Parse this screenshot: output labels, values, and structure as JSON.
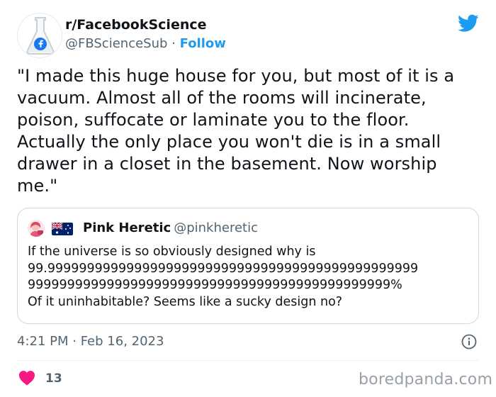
{
  "tweet": {
    "author_name": "r/FacebookScience",
    "author_handle": "@FBScienceSub",
    "separator": "·",
    "follow_label": "Follow",
    "text": "\"I made this huge house for you, but most of it is a vacuum. Almost all of the rooms will incinerate, poison, suffocate or laminate you to the floor. Actually the only place you won't die is in a small drawer in a closet in the basement. Now worship me.\"",
    "timestamp": "4:21 PM · Feb 16, 2023",
    "likes": "13"
  },
  "quoted": {
    "author_name": "Pink Heretic",
    "author_handle": "@pinkheretic",
    "lines": [
      "If the universe is so obviously designed why is",
      "99.99999999999999999999999999999999999999999999999",
      "9999999999999999999999999999999999999999999999%",
      "Of it uninhabitable? Seems like a sucky design no?"
    ]
  },
  "watermark": "boredpanda.com",
  "colors": {
    "accent": "#1d9bf0",
    "heart": "#f91880",
    "text": "#0f1419",
    "muted": "#536471",
    "border": "#cfd9de",
    "facebook_blue": "#1877f2"
  },
  "icons": {
    "avatar": "flask-with-facebook-logo",
    "platform": "twitter-bird-icon",
    "flag": "australia-flag-icon",
    "info": "info-icon",
    "like": "heart-icon"
  }
}
